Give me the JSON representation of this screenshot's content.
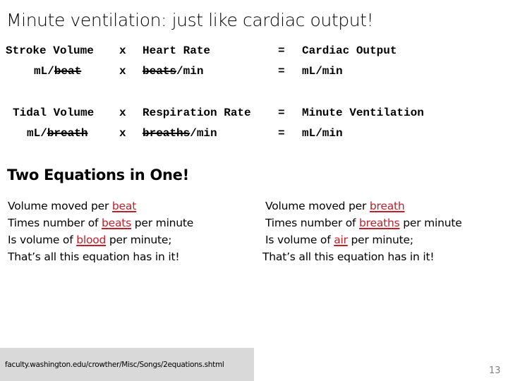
{
  "title": "Minute ventilation: just like cardiac output!",
  "cardiac": {
    "row1": {
      "a": "Stroke Volume",
      "op1": "x",
      "b": "Heart Rate",
      "op2": "=",
      "c": "Cardiac Output"
    },
    "row2": {
      "a_pre": "mL/",
      "a_strike": "beat",
      "op1": "x",
      "b_strike": "beats",
      "b_post": "/min",
      "op2": "=",
      "c": "mL/min"
    }
  },
  "ventilation": {
    "row1": {
      "a": "Tidal Volume",
      "op1": "x",
      "b": "Respiration Rate",
      "op2": "=",
      "c": "Minute Ventilation"
    },
    "row2": {
      "a_pre": "mL/",
      "a_strike": "breath",
      "op1": "x",
      "b_strike": "breaths",
      "b_post": "/min",
      "op2": "=",
      "c": "mL/min"
    }
  },
  "subtitle": "Two Equations in One!",
  "verse_left": [
    {
      "pre": "Volume moved per ",
      "hl": "beat",
      "post": ""
    },
    {
      "pre": "Times number of ",
      "hl": "beats",
      "post": " per minute"
    },
    {
      "pre": "Is volume of ",
      "hl": "blood",
      "post": " per minute;"
    },
    {
      "pre": "That’s all this equation has in it!",
      "hl": "",
      "post": ""
    }
  ],
  "verse_right": [
    {
      "pre": "Volume moved per ",
      "hl": "breath",
      "post": ""
    },
    {
      "pre": "Times number of ",
      "hl": "breaths",
      "post": " per minute"
    },
    {
      "pre": "Is volume of ",
      "hl": "air",
      "post": " per minute;"
    },
    {
      "pre": "That’s all this equation has in it!",
      "hl": "",
      "post": ""
    }
  ],
  "source_url": "faculty.washington.edu/crowther/Misc/Songs/2equations.shtml",
  "page_number": "13",
  "colors": {
    "highlight": "#c0202a",
    "url_box": "#d9d9d9",
    "page_number": "#7f7f7f"
  }
}
